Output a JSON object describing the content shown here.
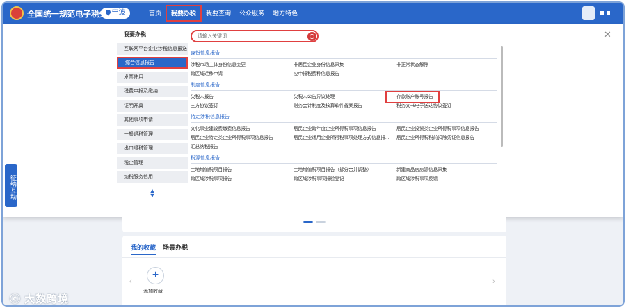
{
  "header": {
    "site_title": "全国统一规范电子税务局",
    "city": "宁波",
    "nav": [
      "首页",
      "我要办税",
      "我要查询",
      "公众服务",
      "地方特色"
    ]
  },
  "sidebar": {
    "heading": "我要办税",
    "items": [
      "互联网平台企业涉税信息报送",
      "综合信息报告",
      "发票使用",
      "税费申报及缴纳",
      "证明开具",
      "其他事项申请",
      "一般退税管理",
      "出口退税管理",
      "税企管理",
      "纳税服务信用"
    ]
  },
  "search": {
    "placeholder": "请输入关键词"
  },
  "sections": [
    {
      "title": "身份信息报告",
      "links": [
        "涉税市场主体身份信息变更",
        "非居民企业身份信息采集",
        "非正常状态解除",
        "跨区域迁移申请",
        "应申报税费种信息报告"
      ]
    },
    {
      "title": "制度信息报告",
      "links": [
        "欠税人报告",
        "欠税人公告异议处理",
        "存款账户账号报告",
        "三方协议签订",
        "财务会计制度及核算软件备案报告",
        "税务文书电子送达协议签订"
      ]
    },
    {
      "title": "特定涉税信息报告",
      "links": [
        "文化事业建设费缴费信息报告",
        "居民企业跨年度企业所得税事项信息报告",
        "居民企业投资类企业所得税事项信息报告",
        "居民企业特定类企业所得税事项信息报告",
        "居民企业适用企业所得税事项处理方式信息报...",
        "居民企业所得税税前扣除凭证信息报告",
        "汇总纳税报告"
      ]
    },
    {
      "title": "税源信息报告",
      "links": [
        "土地增值税项目报告",
        "土地增值税项目报告（拆分合并调整）",
        "新建商品房房源信息采集",
        "跨区域涉税事项报告",
        "跨区域涉税事项报验登记",
        "跨区域涉税事项反馈"
      ]
    }
  ],
  "side_float": "征纳互动",
  "favorites": {
    "tabs": [
      "我的收藏",
      "场景办税"
    ],
    "add_label": "添加收藏"
  },
  "watermark": "大数跨境",
  "colors": {
    "brand": "#2a67c9",
    "highlight": "#e04040"
  }
}
